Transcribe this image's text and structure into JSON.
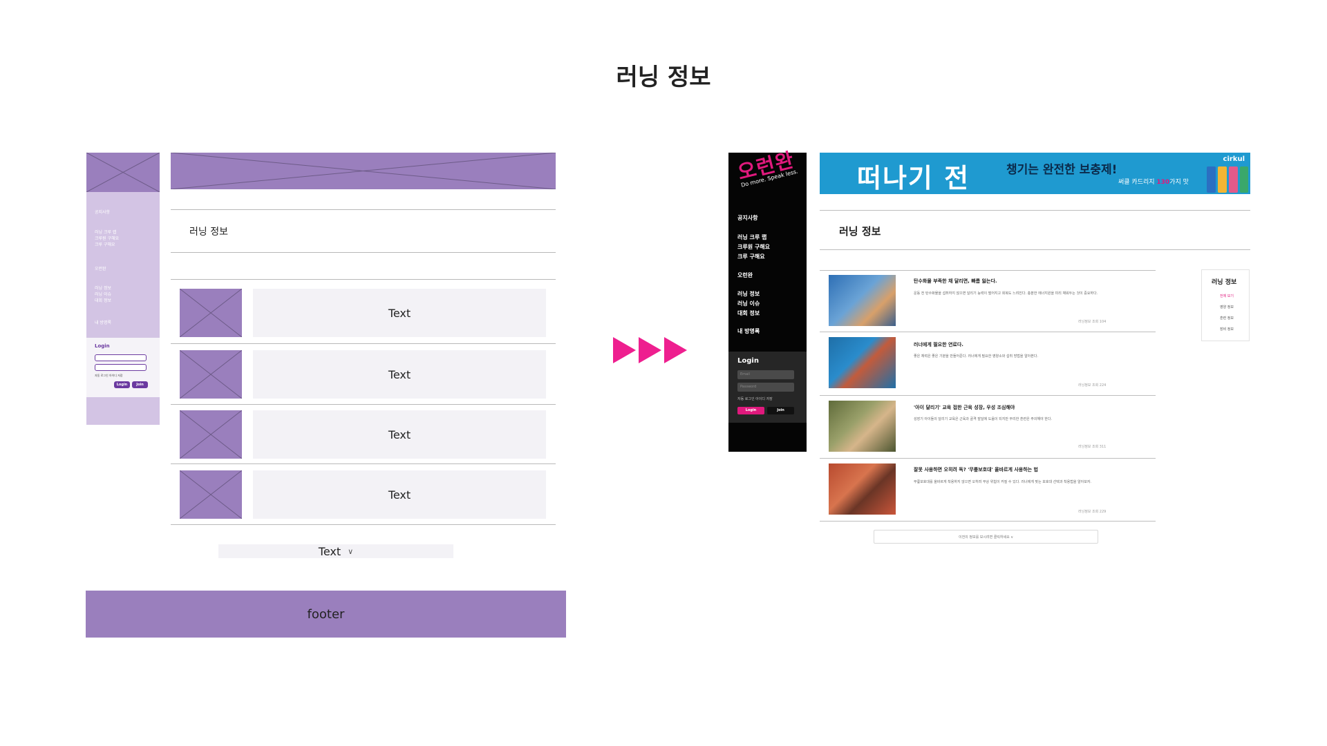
{
  "page": {
    "title": "러닝 정보"
  },
  "wireframe": {
    "menu": [
      "공지사항",
      "러닝 크루 랩",
      "크루원 구해요",
      "크루 구해요",
      "오런완",
      "러닝 정보",
      "러닝 이슈",
      "대회 정보",
      "내 방명록"
    ],
    "login": {
      "title": "Login",
      "checks": "자동 로그인   아이디 저장",
      "login_btn": "Login",
      "join_btn": "Join"
    },
    "section_title": "러닝 정보",
    "rows": [
      "Text",
      "Text",
      "Text",
      "Text"
    ],
    "more_label": "Text",
    "more_icon": "chevron-down-icon",
    "footer": "footer",
    "colors": {
      "placeholder": "#9a7fbd",
      "sidebar": "#d3c4e4",
      "accent": "#6b3aa0"
    }
  },
  "transition": {
    "icon": "triple-arrow-right-icon",
    "color": "#ee1f8f"
  },
  "mockup": {
    "logo": "오런완",
    "logo_tagline": "Do more. Speak less.",
    "menu": [
      "공지사항",
      "러닝 크루 랩",
      "크루원 구해요",
      "크루 구해요",
      "오런완",
      "러닝 정보",
      "러닝 이슈",
      "대회 정보",
      "내 방명록"
    ],
    "login": {
      "title": "Login",
      "email_placeholder": "Email",
      "password_placeholder": "Password",
      "checks": "자동 로그인   아이디 저장",
      "login_btn": "Login",
      "join_btn": "Join"
    },
    "banner": {
      "headline": "떠나기 전",
      "sub": "챙기는 완전한 보충제!",
      "small_prefix": "써클 카드리지 ",
      "small_highlight": "130",
      "small_suffix": "가지 맛",
      "brand": "cirkul"
    },
    "section_title": "러닝 정보",
    "articles": [
      {
        "title": "탄수화물 부족한 채 달리면, 빠름 잃는다.",
        "text": "운동 전 탄수화물을 섭취하지 않으면 달리기 능력이 떨어지고 회복도 느려진다. 충분한 에너지원을 미리 채워두는 것이 중요하다.",
        "meta": "러닝정보   조회 104"
      },
      {
        "title": "러너에게 필요한 연료다.",
        "text": "좋은 체력은 좋은 기분을 만들어준다. 러너에게 필요한 영양소와 섭취 방법을 알아본다.",
        "meta": "러닝정보   조회 224"
      },
      {
        "title": "'아이 달리기' 교육 접한 근육 성장, 우성 조심해야",
        "text": "성장기 아이들의 달리기 교육은 근육과 골격 발달에 도움이 되지만 무리한 훈련은 주의해야 한다.",
        "meta": "러닝정보   조회 311"
      },
      {
        "title": "잘못 사용하면 오히려 독? '무릎보호대' 올바르게 사용하는 법",
        "text": "무릎보호대를 올바르게 착용하지 않으면 오히려 부상 위험이 커질 수 있다. 러너에게 맞는 보호대 선택과 착용법을 알아보자.",
        "meta": "러닝정보   조회 229"
      }
    ],
    "more_label": "이전의 정보를 보시려면 클릭하세요 ∨",
    "category": {
      "title": "러닝 정보",
      "items": [
        "전체 보기",
        "영양 정보",
        "훈련 정보",
        "장비 정보"
      ]
    },
    "colors": {
      "sidebar": "#050505",
      "accent": "#e0197d",
      "banner": "#1f9ad0"
    }
  }
}
